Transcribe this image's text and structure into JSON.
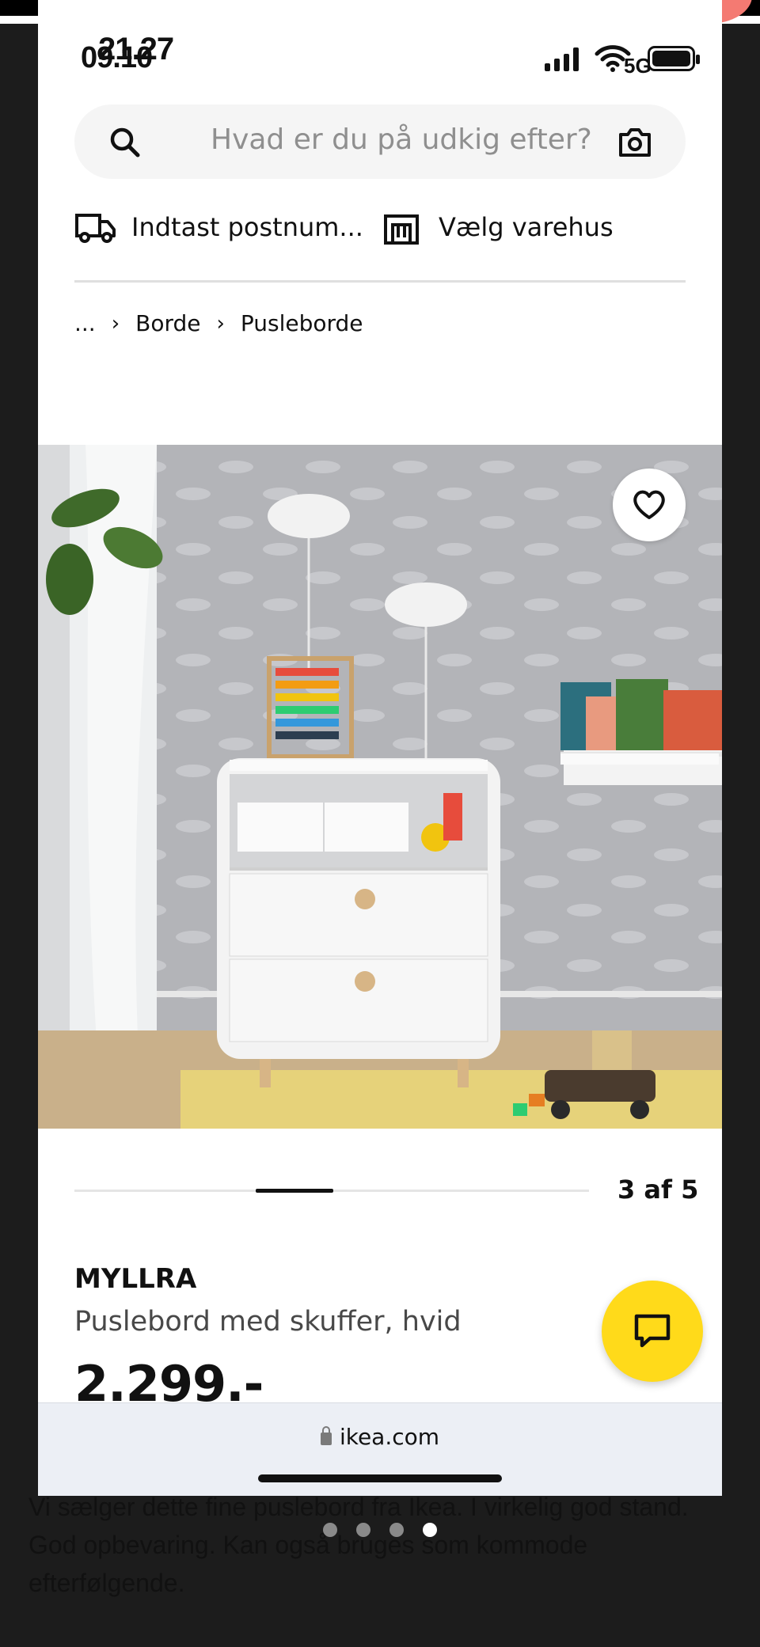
{
  "status": {
    "time_front": "21.27",
    "time_back": "09.10",
    "network": "5G"
  },
  "search": {
    "placeholder": "Hvad er du på udkig efter?"
  },
  "location": {
    "postcode_label": "Indtast postnum...",
    "store_label": "Vælg varehus"
  },
  "breadcrumb": {
    "ellipsis": "...",
    "items": [
      "Borde",
      "Pusleborde"
    ]
  },
  "gallery": {
    "counter": "3 af 5",
    "current": 3,
    "total": 5
  },
  "product": {
    "brand": "MYLLRA",
    "description": "Puslebord med skuffer, hvid",
    "price": "2.299.-"
  },
  "browser": {
    "url": "ikea.com"
  },
  "background_listing": {
    "description": "Vi sælger dette fine puslebord fra Ikea. I virkelig god stand. God opbevaring. Kan også bruges som kommode efterfølgende.",
    "pager_total": 4,
    "pager_active": 4
  },
  "colors": {
    "accent_yellow": "#ffda1a",
    "text": "#111111",
    "muted": "#484848"
  },
  "icons": [
    "search-icon",
    "camera-icon",
    "truck-icon",
    "store-icon",
    "chevron-right-icon",
    "heart-icon",
    "chat-icon",
    "lock-icon"
  ]
}
